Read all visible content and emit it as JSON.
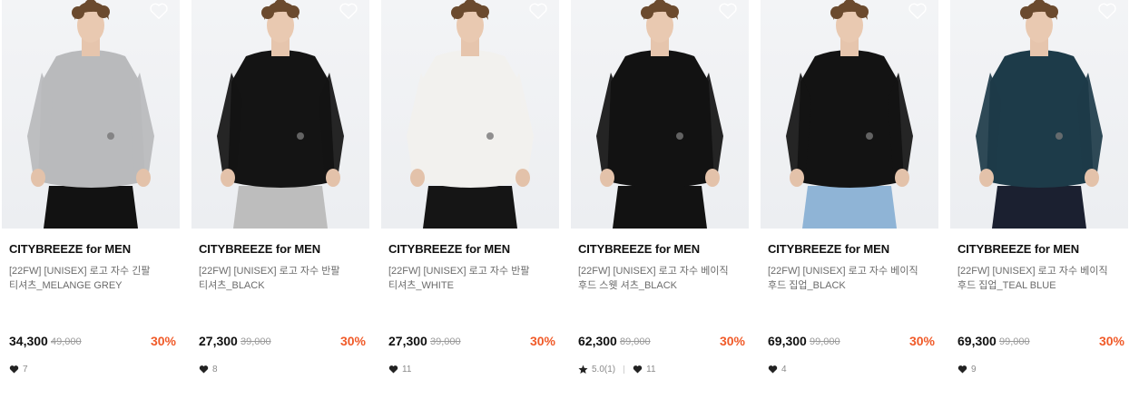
{
  "products": [
    {
      "brand": "CITYBREEZE for MEN",
      "name": "[22FW] [UNISEX] 로고 자수 긴팔 티셔츠_MELANGE GREY",
      "price": "34,300",
      "original_price": "49,000",
      "discount": "30%",
      "likes": "7",
      "rating": null,
      "colors": {
        "garment": "#b9babc",
        "pants": "#121212"
      }
    },
    {
      "brand": "CITYBREEZE for MEN",
      "name": "[22FW] [UNISEX] 로고 자수 반팔 티셔츠_BLACK",
      "price": "27,300",
      "original_price": "39,000",
      "discount": "30%",
      "likes": "8",
      "rating": null,
      "colors": {
        "garment": "#141414",
        "pants": "#bdbdbd"
      }
    },
    {
      "brand": "CITYBREEZE for MEN",
      "name": "[22FW] [UNISEX] 로고 자수 반팔 티셔츠_WHITE",
      "price": "27,300",
      "original_price": "39,000",
      "discount": "30%",
      "likes": "11",
      "rating": null,
      "colors": {
        "garment": "#f2f1ee",
        "pants": "#151515"
      }
    },
    {
      "brand": "CITYBREEZE for MEN",
      "name": "[22FW] [UNISEX] 로고 자수 베이직 후드 스웻 셔츠_BLACK",
      "price": "62,300",
      "original_price": "89,000",
      "discount": "30%",
      "likes": "11",
      "rating": "5.0(1)",
      "colors": {
        "garment": "#121212",
        "pants": "#121212"
      }
    },
    {
      "brand": "CITYBREEZE for MEN",
      "name": "[22FW] [UNISEX] 로고 자수 베이직 후드 집업_BLACK",
      "price": "69,300",
      "original_price": "99,000",
      "discount": "30%",
      "likes": "4",
      "rating": null,
      "colors": {
        "garment": "#131313",
        "pants": "#8fb4d6"
      }
    },
    {
      "brand": "CITYBREEZE for MEN",
      "name": "[22FW] [UNISEX] 로고 자수 베이직 후드 집업_TEAL BLUE",
      "price": "69,300",
      "original_price": "99,000",
      "discount": "30%",
      "likes": "9",
      "rating": null,
      "colors": {
        "garment": "#1d3b49",
        "pants": "#1b2030"
      }
    }
  ],
  "theme": {
    "discount_color": "#f05a28",
    "text_primary": "#111111",
    "text_secondary": "#6b6b6b",
    "text_muted": "#9a9a9a"
  },
  "icons": {
    "wishlist": "heart-outline-icon",
    "likes": "heart-filled-icon",
    "rating": "star-icon"
  }
}
